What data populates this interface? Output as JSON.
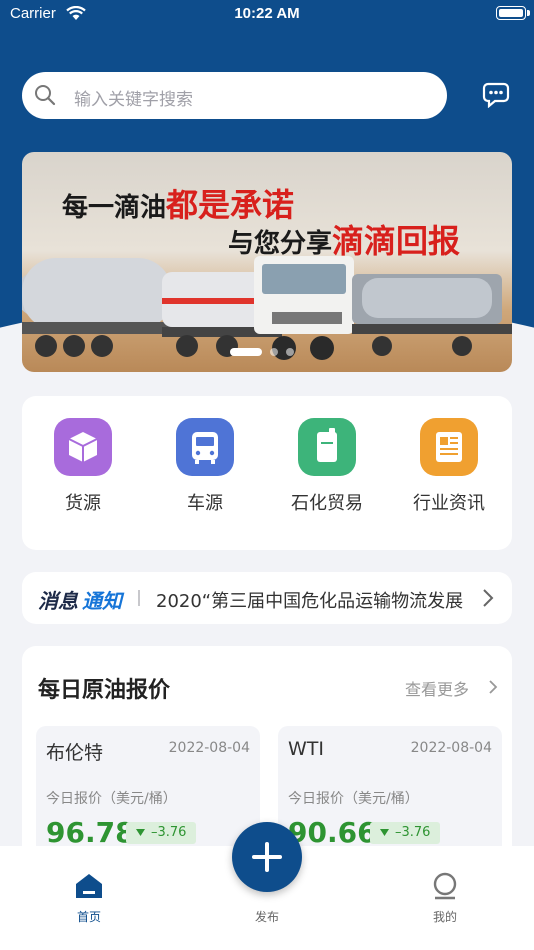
{
  "status_bar": {
    "carrier": "Carrier",
    "time": "10:22 AM"
  },
  "search": {
    "placeholder": "输入关键字搜索"
  },
  "banner": {
    "line1_prefix": "每一滴油",
    "line1_highlight": "都是承诺",
    "line2_prefix": "与您分享",
    "line2_highlight": "滴滴回报"
  },
  "quick_menu": [
    {
      "label": "货源",
      "icon": "box-icon",
      "color": "#a86bdc"
    },
    {
      "label": "车源",
      "icon": "bus-icon",
      "color": "#4f74d6"
    },
    {
      "label": "石化贸易",
      "icon": "canister-icon",
      "color": "#3db47a"
    },
    {
      "label": "行业资讯",
      "icon": "newspaper-icon",
      "color": "#f0a030"
    }
  ],
  "notice": {
    "title_part1": "消息",
    "title_part2": "通知",
    "text": "2020“第三届中国危化品运输物流发展"
  },
  "prices": {
    "title": "每日原油报价",
    "more": "查看更多",
    "cards": [
      {
        "name": "布伦特",
        "date": "2022-08-04",
        "label": "今日报价（美元/桶）",
        "price": "96.78",
        "change": "–3.76"
      },
      {
        "name": "WTI",
        "date": "2022-08-04",
        "label": "今日报价（美元/桶）",
        "price": "90.66",
        "change": "–3.76"
      }
    ]
  },
  "tabbar": {
    "home": "首页",
    "publish": "发布",
    "mine": "我的"
  },
  "colors": {
    "primary": "#0e4d8c",
    "price_down": "#2e9432",
    "highlight_red": "#d8201c"
  }
}
